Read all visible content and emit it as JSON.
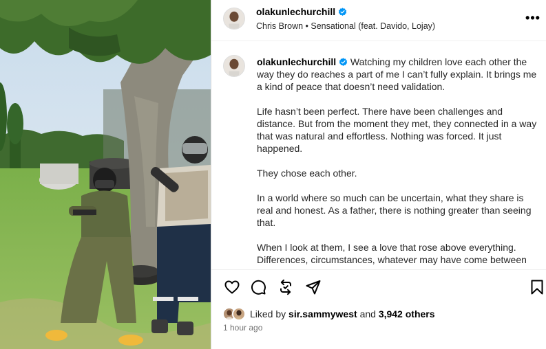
{
  "header": {
    "username": "olakunlechurchill",
    "audio": "Chris Brown • Sensational (feat. Davido, Lojay)",
    "more_label": "•••"
  },
  "caption": {
    "username": "olakunlechurchill",
    "paragraphs": [
      "Watching my children love each other the way they do reaches a part of me I can’t fully explain. It brings me a kind of peace that doesn’t need validation.",
      "Life hasn’t been perfect. There have been challenges and distance. But from the moment they met, they connected in a way that was natural and effortless. Nothing was forced. It just happened.",
      "They chose each other.",
      "In a world where so much can be uncertain, what they share is real and honest. As a father, there is nothing greater than seeing that.",
      "When I look at them, I see a love that rose above everything. Differences, circumstances, whatever may have come between"
    ]
  },
  "actions": {
    "icons": [
      "heart-icon",
      "comment-icon",
      "repost-icon",
      "share-icon",
      "bookmark-icon"
    ]
  },
  "likes": {
    "prefix": "Liked by",
    "user": "sir.sammywest",
    "joiner": "and",
    "others": "3,942 others"
  },
  "timestamp": "1 hour ago",
  "colors": {
    "verified": "#0095f6",
    "text": "#262626",
    "secondary": "#737373",
    "divider": "#efefef"
  }
}
